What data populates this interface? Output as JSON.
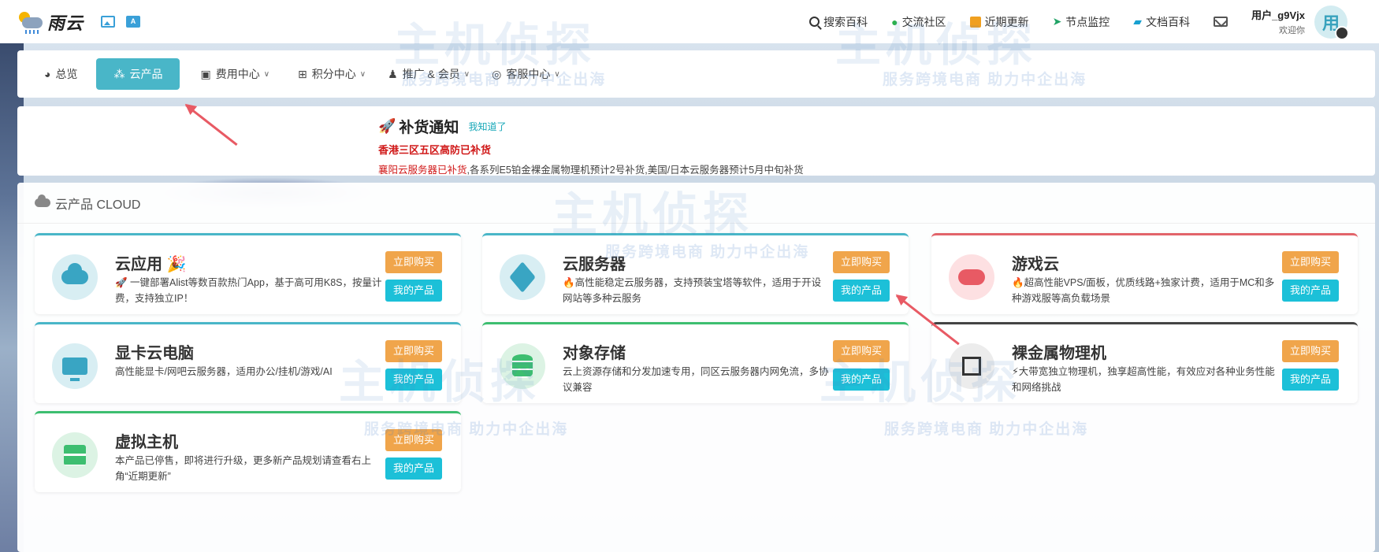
{
  "header": {
    "logo_text": "雨云",
    "nav": [
      {
        "label": "搜索百科",
        "icon": "search-icon"
      },
      {
        "label": "交流社区",
        "icon": "chat-icon"
      },
      {
        "label": "近期更新",
        "icon": "news-icon"
      },
      {
        "label": "节点监控",
        "icon": "send-icon"
      },
      {
        "label": "文档百科",
        "icon": "book-icon"
      }
    ],
    "user_name": "用户_g9Vjx",
    "user_greeting": "欢迎你",
    "avatar_char": "用"
  },
  "navbar": {
    "items": [
      {
        "label": "总览",
        "active": false,
        "dropdown": false
      },
      {
        "label": "云产品",
        "active": true,
        "dropdown": false
      },
      {
        "label": "费用中心",
        "active": false,
        "dropdown": true
      },
      {
        "label": "积分中心",
        "active": false,
        "dropdown": true
      },
      {
        "label": "推广 & 会员",
        "active": false,
        "dropdown": true
      },
      {
        "label": "客服中心",
        "active": false,
        "dropdown": true
      }
    ]
  },
  "notice": {
    "title": "补货通知",
    "ack_link": "我知道了",
    "line1": "香港三区五区高防已补货",
    "line2_red": "襄阳云服务器已补货",
    "line2_rest": ",各系列E5铂金裸金属物理机预计2号补货,美国/日本云服务器预计5月中旬补货"
  },
  "panel": {
    "title": "云产品 CLOUD",
    "buy_label": "立即购买",
    "my_label": "我的产品",
    "products": [
      {
        "name": "云应用",
        "emoji": "🎉",
        "desc": "🚀 一键部署Alist等数百款热门App，基于高可用K8S，按量计费，支持独立IP！"
      },
      {
        "name": "云服务器",
        "emoji": "",
        "desc": "🔥高性能稳定云服务器，支持预装宝塔等软件，适用于开设网站等多种云服务"
      },
      {
        "name": "游戏云",
        "emoji": "",
        "desc": "🔥超高性能VPS/面板，优质线路+独家计费，适用于MC和多种游戏服等高负载场景"
      },
      {
        "name": "显卡云电脑",
        "emoji": "",
        "desc": "高性能显卡/网吧云服务器，适用办公/挂机/游戏/AI"
      },
      {
        "name": "对象存储",
        "emoji": "",
        "desc": "云上资源存储和分发加速专用，同区云服务器内网免流，多协议兼容"
      },
      {
        "name": "裸金属物理机",
        "emoji": "",
        "desc": "⚡大带宽独立物理机，独享超高性能，有效应对各种业务性能和网络挑战"
      },
      {
        "name": "虚拟主机",
        "emoji": "",
        "desc": "本产品已停售，即将进行升级，更多新产品规划请查看右上角“近期更新”"
      }
    ]
  },
  "watermark": {
    "text": "服务跨境电商  助力中企出海",
    "big": "主机侦探"
  }
}
